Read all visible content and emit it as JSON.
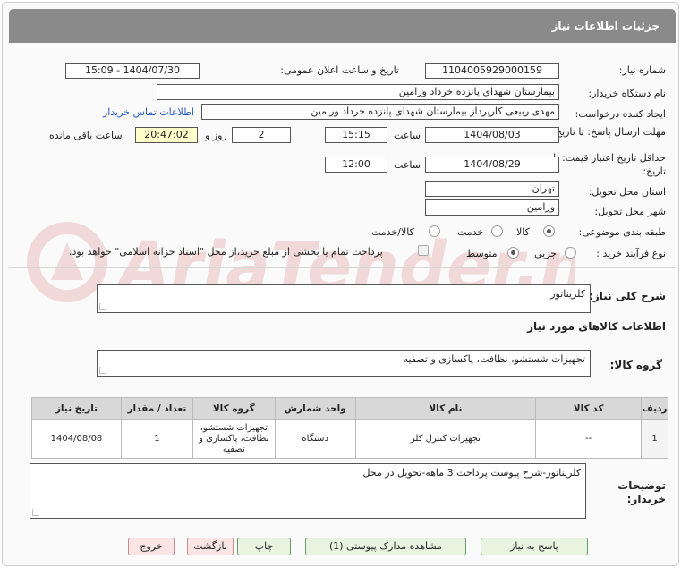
{
  "header": {
    "title": "جزئیات اطلاعات نیاز"
  },
  "fields": {
    "need_number_label": "شماره نیاز:",
    "need_number": "1104005929000159",
    "announce_label": "تاریخ و ساعت اعلان عمومی:",
    "announce_value": "1404/07/30 - 15:09",
    "buyer_org_label": "نام دستگاه خریدار:",
    "buyer_org": "بیمارستان شهدای پانزده خرداد ورامین",
    "creator_label": "ایجاد کننده درخواست:",
    "creator": "مهدی ربیعی کارپرداز بیمارستان شهدای پانزده خرداد ورامین",
    "contact_link": "اطلاعات تماس خریدار",
    "send_deadline_label": "مهلت ارسال پاسخ: تا تاریخ:",
    "send_date": "1404/08/03",
    "time_label": "ساعت",
    "send_time": "15:15",
    "days": "2",
    "days_label": "روز و",
    "remaining": "20:47:02",
    "remaining_label": "ساعت باقی مانده",
    "validity_label": "حداقل تاریخ اعتبار قیمت: تا تاریخ:",
    "validity_date": "1404/08/29",
    "validity_time": "12:00",
    "province_label": "استان محل تحویل:",
    "province": "تهران",
    "city_label": "شهر محل تحویل:",
    "city": "ورامین",
    "category_label": "طبقه بندی موضوعی:",
    "category_options": [
      "کالا",
      "خدمت",
      "کالا/خدمت"
    ],
    "process_label": "نوع فرآیند خرید :",
    "process_options": [
      "جزیی",
      "متوسط"
    ],
    "payment_note": "پرداخت تمام یا بخشی از مبلغ خرید،از محل \"اسناد خزانه اسلامی\" خواهد بود."
  },
  "summary": {
    "label": "شرح کلی نیاز:",
    "value": "کلریناتور"
  },
  "goods_info_title": "اطلاعات کالاهای مورد نیاز",
  "goods_group": {
    "label": "گروه کالا:",
    "value": "تجهیزات شستشو، نظافت، پاکسازی و تصفیه"
  },
  "table": {
    "headers": [
      "ردیف",
      "کد کالا",
      "نام کالا",
      "واحد شمارش",
      "گروه کالا",
      "تعداد / مقدار",
      "تاریخ نیاز"
    ],
    "rows": [
      {
        "row": "1",
        "code": "--",
        "name": "تجهیزات کنترل کلر",
        "unit": "دستگاه",
        "group": "تجهیزات شستشو، نظافت، پاکسازی و تصفیه",
        "qty": "1",
        "date": "1404/08/08"
      }
    ]
  },
  "notes": {
    "label": "توضیحات خریدار:",
    "value": "کلریناتور-شرح پیوست پرداخت 3 ماهه-تحویل در محل"
  },
  "buttons": {
    "reply": "پاسخ به نیاز",
    "docs": "مشاهده مدارک پیوستی (1)",
    "print": "چاپ",
    "back": "بازگشت",
    "exit": "خروج"
  },
  "watermark": {
    "text": "AriaTender.neT"
  },
  "colors": {
    "header": "#8a8a8a",
    "link": "#2357c6",
    "button": "#e8f4e0",
    "button_red": "#fbe4e4",
    "watermark": "#e7b2b2"
  }
}
